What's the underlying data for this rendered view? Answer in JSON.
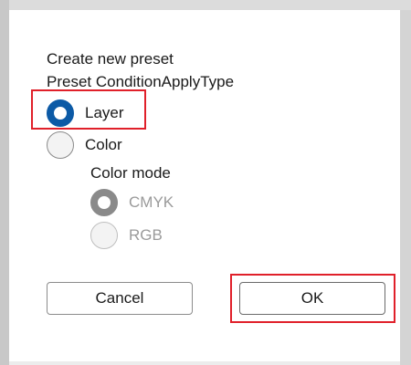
{
  "dialog": {
    "heading": "Create new preset",
    "condition_label": "Preset ConditionApplyType",
    "condition_options": [
      {
        "label": "Layer",
        "checked": true
      },
      {
        "label": "Color",
        "checked": false
      }
    ],
    "color_mode_label": "Color mode",
    "color_mode_options": [
      {
        "label": "CMYK",
        "checked": true,
        "disabled": true
      },
      {
        "label": "RGB",
        "checked": false,
        "disabled": true
      }
    ],
    "cancel_label": "Cancel",
    "ok_label": "OK"
  },
  "colors": {
    "accent": "#0c5aa6",
    "highlight": "#e0202a",
    "disabled_text": "#9a9a9a"
  }
}
